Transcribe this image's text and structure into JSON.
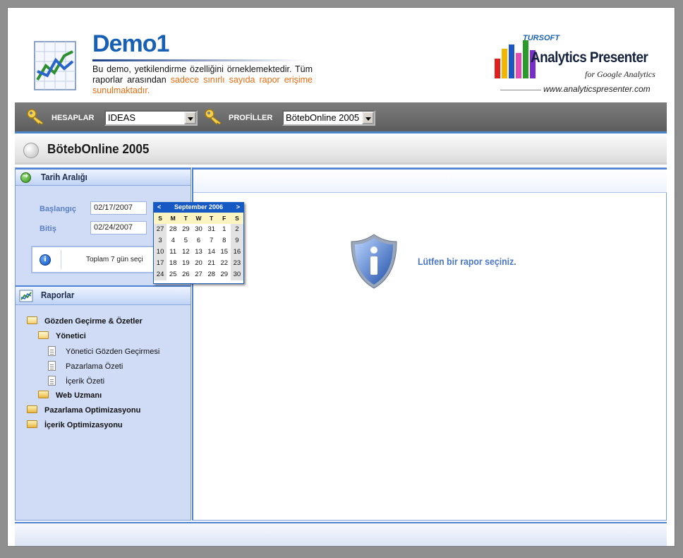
{
  "header": {
    "title": "Demo1",
    "desc_plain": "Bu demo, yetkilendirme özelliğini örneklemektedir. Tüm raporlar arasından",
    "desc_highlight": "sadece sınırlı sayıda rapor erişime sunulmaktadır.",
    "brand_small": "TURSOFT",
    "brand_name": "Analytics Presenter",
    "brand_sub": "for Google Analytics",
    "brand_url": "www.analyticspresenter.com"
  },
  "toolbar": {
    "accounts_label": "HESAPLAR",
    "accounts_value": "IDEAS",
    "profiles_label": "PROFİLLER",
    "profiles_value": "BötebOnline 2005"
  },
  "section": {
    "title": "BötebOnline 2005"
  },
  "date_range": {
    "title": "Tarih Aralığı",
    "start_label": "Başlangıç",
    "start_value": "02/17/2007",
    "end_label": "Bitiş",
    "end_value": "02/24/2007",
    "info_text": "Toplam 7 gün seçi"
  },
  "reports": {
    "title": "Raporlar",
    "items": [
      {
        "label": "Gözden Geçirme & Özetler"
      },
      {
        "label": "Yönetici"
      },
      {
        "label": "Yönetici Gözden Geçirmesi"
      },
      {
        "label": "Pazarlama Özeti"
      },
      {
        "label": "İçerik Özeti"
      },
      {
        "label": "Web Uzmanı"
      },
      {
        "label": "Pazarlama Optimizasyonu"
      },
      {
        "label": "İçerik Optimizasyonu"
      }
    ]
  },
  "main": {
    "message": "Lütfen bir rapor seçiniz."
  },
  "calendar": {
    "prev": "<",
    "next": ">",
    "title": "September 2006",
    "days": [
      "S",
      "M",
      "T",
      "W",
      "T",
      "F",
      "S"
    ],
    "weeks": [
      [
        "27",
        "28",
        "29",
        "30",
        "31",
        "1",
        "2"
      ],
      [
        "3",
        "4",
        "5",
        "6",
        "7",
        "8",
        "9"
      ],
      [
        "10",
        "11",
        "12",
        "13",
        "14",
        "15",
        "16"
      ],
      [
        "17",
        "18",
        "19",
        "20",
        "21",
        "22",
        "23"
      ],
      [
        "24",
        "25",
        "26",
        "27",
        "28",
        "29",
        "30"
      ]
    ]
  },
  "colors": {
    "accent": "#1760b6",
    "highlight": "#ee6a10",
    "panel": "#d0dcf6"
  }
}
